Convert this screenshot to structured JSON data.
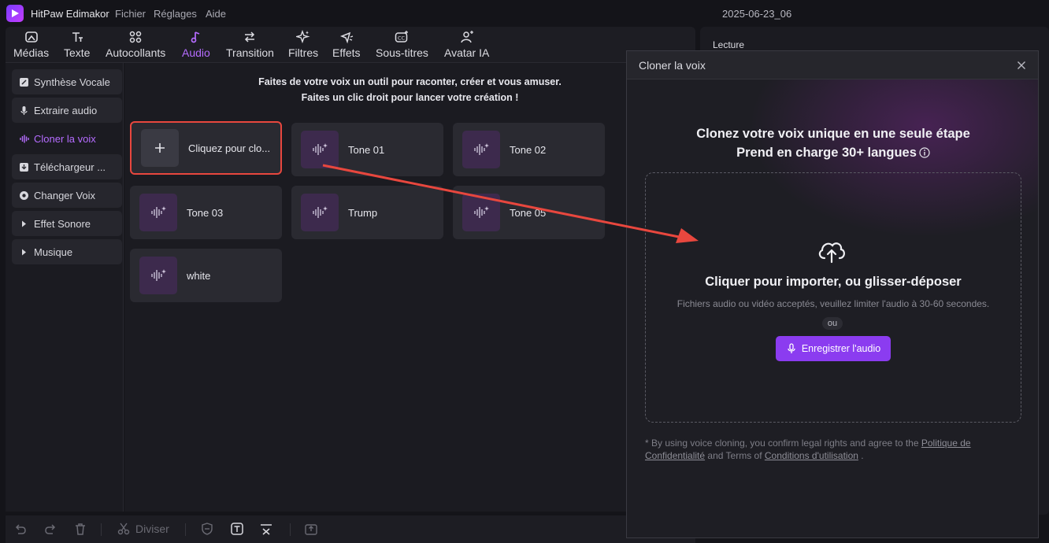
{
  "app": {
    "name": "HitPaw Edimakor",
    "menus": [
      "Fichier",
      "Réglages",
      "Aide"
    ],
    "project_name": "2025-06-23_06"
  },
  "toolbar": {
    "tabs": [
      {
        "label": "Médias",
        "icon": "media-icon"
      },
      {
        "label": "Texte",
        "icon": "text-icon"
      },
      {
        "label": "Autocollants",
        "icon": "stickers-icon"
      },
      {
        "label": "Audio",
        "icon": "audio-icon",
        "active": true
      },
      {
        "label": "Transition",
        "icon": "transition-icon"
      },
      {
        "label": "Filtres",
        "icon": "filters-icon"
      },
      {
        "label": "Effets",
        "icon": "effects-icon"
      },
      {
        "label": "Sous-titres",
        "icon": "subtitles-icon"
      },
      {
        "label": "Avatar IA",
        "icon": "avatar-icon"
      }
    ]
  },
  "preview": {
    "label": "Lecture"
  },
  "sidebar": {
    "items": [
      {
        "label": "Synthèse Vocale",
        "icon": "tts-icon"
      },
      {
        "label": "Extraire audio",
        "icon": "mic-icon"
      },
      {
        "label": "Cloner la voix",
        "icon": "waveform-icon",
        "active": true
      },
      {
        "label": "Téléchargeur ...",
        "icon": "download-icon"
      },
      {
        "label": "Changer Voix",
        "icon": "voice-change-icon"
      },
      {
        "label": "Effet Sonore",
        "icon": "caret-right-icon"
      },
      {
        "label": "Musique",
        "icon": "caret-right-icon"
      }
    ]
  },
  "main": {
    "headline_1": "Faites de votre voix un outil pour raconter, créer et vous amuser.",
    "headline_2": "Faites un clic droit pour lancer votre création !",
    "cards": [
      {
        "label": "Cliquez pour clo..."
      },
      {
        "label": "Tone 01"
      },
      {
        "label": "Tone 02"
      },
      {
        "label": "Tone 03"
      },
      {
        "label": "Trump"
      },
      {
        "label": "Tone 05"
      },
      {
        "label": "white"
      }
    ]
  },
  "bottombar": {
    "split_label": "Diviser"
  },
  "modal": {
    "title": "Cloner la voix",
    "heading_1": "Clonez votre voix unique en une seule étape",
    "heading_2": "Prend en charge 30+ langues",
    "drop_title": "Cliquer pour importer, ou glisser-déposer",
    "drop_subtitle": "Fichiers audio ou vidéo acceptés, veuillez limiter l'audio à 30-60 secondes.",
    "or_label": "ou",
    "record_button": "Enregistrer l'audio",
    "legal_prefix": "* By using voice cloning, you confirm legal rights and agree to the ",
    "legal_link_1": "Politique de Confidentialité",
    "legal_mid": " and Terms of ",
    "legal_link_2": "Conditions d'utilisation",
    "legal_suffix": " ."
  },
  "colors": {
    "accent": "#b56cff",
    "button": "#8b3cf0",
    "highlight": "#e8473e"
  }
}
